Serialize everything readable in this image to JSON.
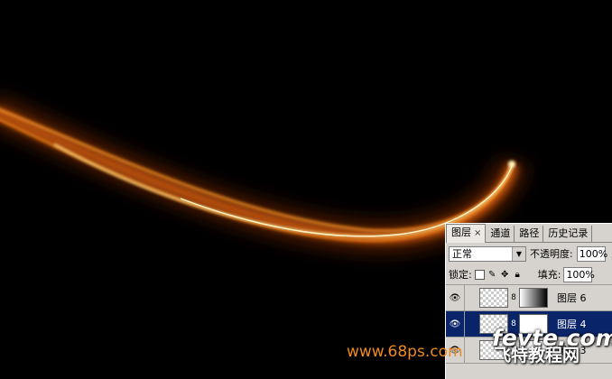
{
  "colors": {
    "background": "#000000",
    "glow_outer": "#a33a00",
    "glow_mid": "#ff8a1a",
    "glow_core": "#fff2b0",
    "selection": "#0a246a",
    "watermark_orange": "#f08a1f"
  },
  "layers_panel": {
    "tabs": [
      {
        "label": "图层",
        "close": "×",
        "active": true
      },
      {
        "label": "通道",
        "active": false
      },
      {
        "label": "路径",
        "active": false
      },
      {
        "label": "历史记录",
        "active": false
      }
    ],
    "blend_mode": "正常",
    "opacity_label": "不透明度:",
    "opacity_value": "100%",
    "lock_label": "锁定:",
    "fill_label": "填充:",
    "fill_value": "100%",
    "layers": [
      {
        "name": "图层 6",
        "visible": true,
        "selected": false,
        "mask": "gradient"
      },
      {
        "name": "图层 4",
        "visible": true,
        "selected": true,
        "mask": "white"
      },
      {
        "name": "图层 3",
        "visible": true,
        "selected": false,
        "mask": "white"
      }
    ]
  },
  "watermarks": {
    "left": "www.68ps.com",
    "right_en": "fevte.com",
    "right_cn": "飞特教程网"
  }
}
